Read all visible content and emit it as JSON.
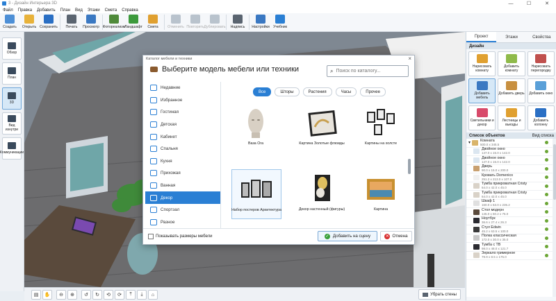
{
  "window": {
    "title": "3 - Дизайн Интерьера 3D",
    "min": "—",
    "max": "☐",
    "close": "✕"
  },
  "menu": [
    "Файл",
    "Правка",
    "Добавить",
    "План",
    "Вид",
    "Этажи",
    "Смета",
    "Справка"
  ],
  "toolbar": [
    {
      "label": "Создать",
      "icon": "new-file-icon",
      "color": "#4d8fd6",
      "enabled": true
    },
    {
      "label": "Открыть",
      "icon": "folder-icon",
      "color": "#e8b23a",
      "enabled": true
    },
    {
      "label": "Сохранить",
      "icon": "save-icon",
      "color": "#2a6fc4",
      "enabled": true
    },
    {
      "label": "Печать",
      "icon": "printer-icon",
      "color": "#5a6470",
      "enabled": true
    },
    {
      "label": "Просмотр",
      "icon": "monitor-icon",
      "color": "#3a78c2",
      "enabled": true
    },
    {
      "label": "Фотореализм",
      "icon": "photo-icon",
      "color": "#4f8a3a",
      "enabled": true
    },
    {
      "label": "Ландшафт",
      "icon": "tree-icon",
      "color": "#3c9a3c",
      "enabled": true
    },
    {
      "label": "Смета",
      "icon": "estimate-icon",
      "color": "#e0a030",
      "enabled": true
    },
    {
      "label": "Отменить",
      "icon": "undo-icon",
      "color": "#b9c3cd",
      "enabled": false
    },
    {
      "label": "Повторить",
      "icon": "redo-icon",
      "color": "#b9c3cd",
      "enabled": false
    },
    {
      "label": "Дублировать",
      "icon": "duplicate-icon",
      "color": "#b9c3cd",
      "enabled": false
    },
    {
      "label": "Надпись",
      "icon": "text-icon",
      "color": "#5a6470",
      "enabled": true
    },
    {
      "label": "Настройки",
      "icon": "gear-icon",
      "color": "#3a78c2",
      "enabled": true
    },
    {
      "label": "Учебник",
      "icon": "help-icon",
      "color": "#2a7fd4",
      "enabled": true
    }
  ],
  "leftbar": [
    {
      "label": "Обзор",
      "icon": "overview-icon",
      "active": false
    },
    {
      "label": "План",
      "icon": "plan-icon",
      "active": false
    },
    {
      "label": "3D",
      "icon": "3d-icon",
      "active": true
    },
    {
      "label": "Вид изнутри",
      "icon": "inside-view-icon",
      "active": false
    },
    {
      "label": "Коммуникации",
      "icon": "communications-icon",
      "active": false
    }
  ],
  "right_tabs": [
    {
      "label": "Проект",
      "active": true
    },
    {
      "label": "Этажи",
      "active": false
    },
    {
      "label": "Свойства",
      "active": false
    }
  ],
  "design": {
    "heading": "Дизайн",
    "buttons": [
      {
        "label": "Нарисовать комнату",
        "color": "#e0a030",
        "active": false
      },
      {
        "label": "Добавить комнату",
        "color": "#8fba4a",
        "active": false
      },
      {
        "label": "Нарисовать перегородку",
        "color": "#c0504d",
        "active": false
      },
      {
        "label": "Добавить мебель",
        "color": "#3a78c2",
        "active": true
      },
      {
        "label": "Добавить дверь",
        "color": "#c89040",
        "active": false
      },
      {
        "label": "Добавить окно",
        "color": "#5aa0d8",
        "active": false
      },
      {
        "label": "Светильники и декор",
        "color": "#d84a6a",
        "active": false
      },
      {
        "label": "Лестницы и выезды",
        "color": "#e0a030",
        "active": false
      },
      {
        "label": "Добавить колонну",
        "color": "#2a6fc4",
        "active": false
      }
    ]
  },
  "objects": {
    "heading": "Список объектов",
    "view_label": "Вид списка",
    "root": {
      "name": "Комната",
      "size": "500.0 x 345.5"
    },
    "items": [
      {
        "name": "Двойное окно",
        "size": "147.0 x 15.0 x 142.0"
      },
      {
        "name": "Двойное окно",
        "size": "147.0 x 15.0 x 142.0"
      },
      {
        "name": "Дверь",
        "size": "90.0 x 15.0 x 200.0"
      },
      {
        "name": "Кровать Domenico",
        "size": "251.2 x 213.0 x 107.0"
      },
      {
        "name": "Тумба прикроватная Cristy",
        "size": "64.0 x 42.0 x 45.0"
      },
      {
        "name": "Тумба прикроватная Cristy",
        "size": "64.0 x 42.0 x 45.0"
      },
      {
        "name": "Шкаф 1",
        "size": "160.0 x 63.0 x 235.2"
      },
      {
        "name": "Стол модерн",
        "size": "145.0 x 60.2 x 76.0"
      },
      {
        "name": "Ноутбук",
        "size": "36.6 x 27.4 x 26.3"
      },
      {
        "name": "Стул Edwin",
        "size": "45.2 x 63.5 x 100.0"
      },
      {
        "name": "Полка классическая",
        "size": "172.0 x 30.0 x 35.0"
      },
      {
        "name": "Тумба с ТВ",
        "size": "98.0 x 48.0 x 121.7"
      },
      {
        "name": "Зеркало гримерное",
        "size": "79.9 x 8.5 x 175.0"
      }
    ]
  },
  "bottom": {
    "remove_walls": "Убрать стены",
    "tools": [
      "page-icon",
      "hand-icon",
      "zoom-out-icon",
      "zoom-in-icon",
      "rotate-left-icon",
      "rotate-right-icon",
      "orbit-left-icon",
      "orbit-right-icon",
      "tilt-up-icon",
      "tilt-down-icon",
      "home-icon"
    ]
  },
  "dialog": {
    "window_title": "Каталог мебели и техники",
    "heading": "Выберите модель мебели или техники",
    "search_placeholder": "Поиск по каталогу...",
    "categories": [
      {
        "label": "Недавние",
        "active": false
      },
      {
        "label": "Избранное",
        "active": false
      },
      {
        "label": "Гостиная",
        "active": false
      },
      {
        "label": "Детская",
        "active": false
      },
      {
        "label": "Кабинет",
        "active": false
      },
      {
        "label": "Спальня",
        "active": false
      },
      {
        "label": "Кухня",
        "active": false
      },
      {
        "label": "Прихожая",
        "active": false
      },
      {
        "label": "Ванная",
        "active": false
      },
      {
        "label": "Декор",
        "active": true
      },
      {
        "label": "Спортзал",
        "active": false
      },
      {
        "label": "Разное",
        "active": false
      }
    ],
    "filters": [
      {
        "label": "Все",
        "active": true
      },
      {
        "label": "Шторы",
        "active": false
      },
      {
        "label": "Растения",
        "active": false
      },
      {
        "label": "Часы",
        "active": false
      },
      {
        "label": "Прочее",
        "active": false
      }
    ],
    "items": [
      {
        "caption": "Ваза Ora",
        "selected": false
      },
      {
        "caption": "Картина Золотые флюиды",
        "selected": false
      },
      {
        "caption": "Картины на холсте",
        "selected": false
      },
      {
        "caption": "Набор постеров Архитектура",
        "selected": true
      },
      {
        "caption": "Декор настенный (фигуры)",
        "selected": false
      },
      {
        "caption": "Картина",
        "selected": false
      },
      {
        "caption": "",
        "selected": false
      },
      {
        "caption": "",
        "selected": false
      },
      {
        "caption": "",
        "selected": false
      }
    ],
    "show_sizes": "Показывать размеры мебели",
    "add_button": "Добавить на сцену",
    "cancel_button": "Отмена"
  }
}
